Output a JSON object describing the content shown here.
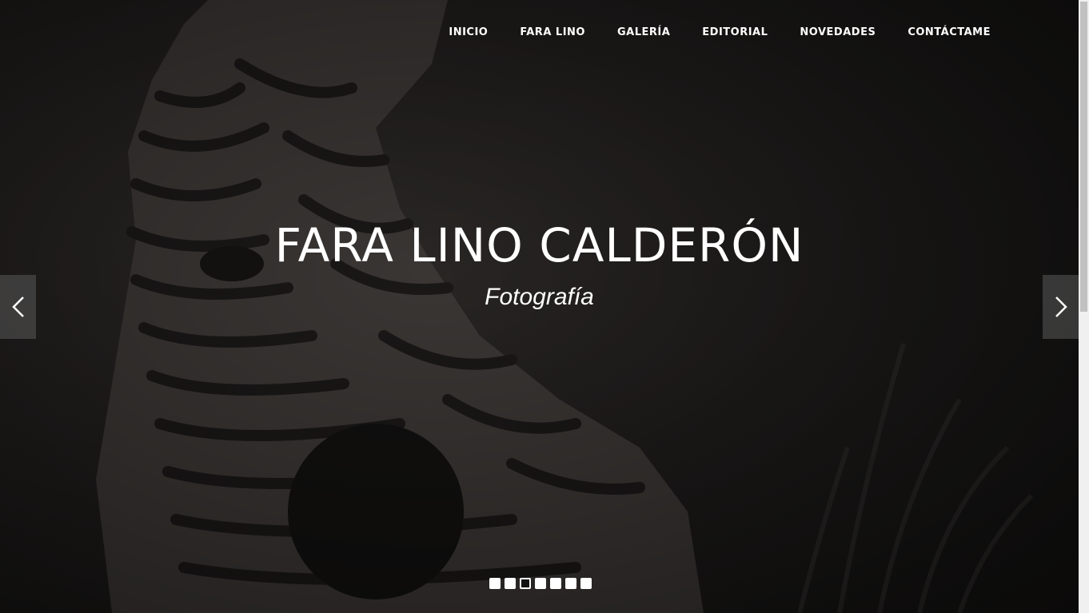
{
  "nav": {
    "items": [
      {
        "label": "INICIO"
      },
      {
        "label": "FARA LINO"
      },
      {
        "label": "GALERÍA"
      },
      {
        "label": "EDITORIAL"
      },
      {
        "label": "NOVEDADES"
      },
      {
        "label": "CONTÁCTAME"
      }
    ]
  },
  "hero": {
    "title": "FARA LINO CALDERÓN",
    "subtitle": "Fotografía",
    "prev_icon": "chevron-left-icon",
    "next_icon": "chevron-right-icon"
  },
  "slider": {
    "slide_count": 7,
    "active_index": 2
  },
  "colors": {
    "background": "#1b1918",
    "text": "#ffffff",
    "arrow_bg": "#5a5a5a"
  }
}
